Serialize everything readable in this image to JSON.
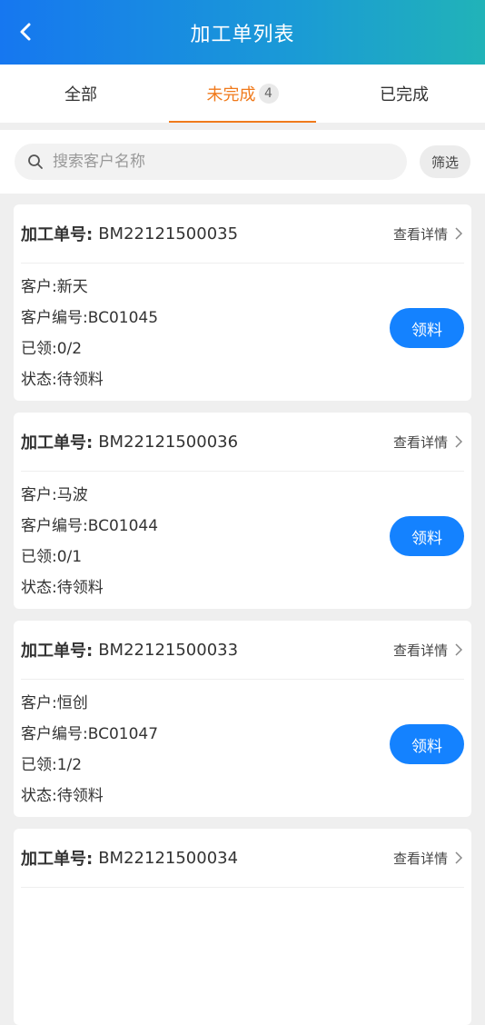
{
  "header": {
    "title": "加工单列表"
  },
  "tabs": [
    {
      "label": "全部"
    },
    {
      "label": "未完成",
      "badge": "4"
    },
    {
      "label": "已完成"
    }
  ],
  "search": {
    "placeholder": "搜索客户名称",
    "filter_label": "筛选"
  },
  "labels": {
    "order_no": "加工单号:",
    "detail": "查看详情",
    "customer": "客户:",
    "customer_code": "客户编号:",
    "claimed": "已领:",
    "status": "状态:",
    "claim_button": "领料"
  },
  "orders": [
    {
      "order_no": "BM22121500035",
      "customer": "新天",
      "customer_code": "BC01045",
      "claimed": "0/2",
      "status": "待领料"
    },
    {
      "order_no": "BM22121500036",
      "customer": "马波",
      "customer_code": "BC01044",
      "claimed": "0/1",
      "status": "待领料"
    },
    {
      "order_no": "BM22121500033",
      "customer": "恒创",
      "customer_code": "BC01047",
      "claimed": "1/2",
      "status": "待领料"
    },
    {
      "order_no": "BM22121500034"
    }
  ]
}
